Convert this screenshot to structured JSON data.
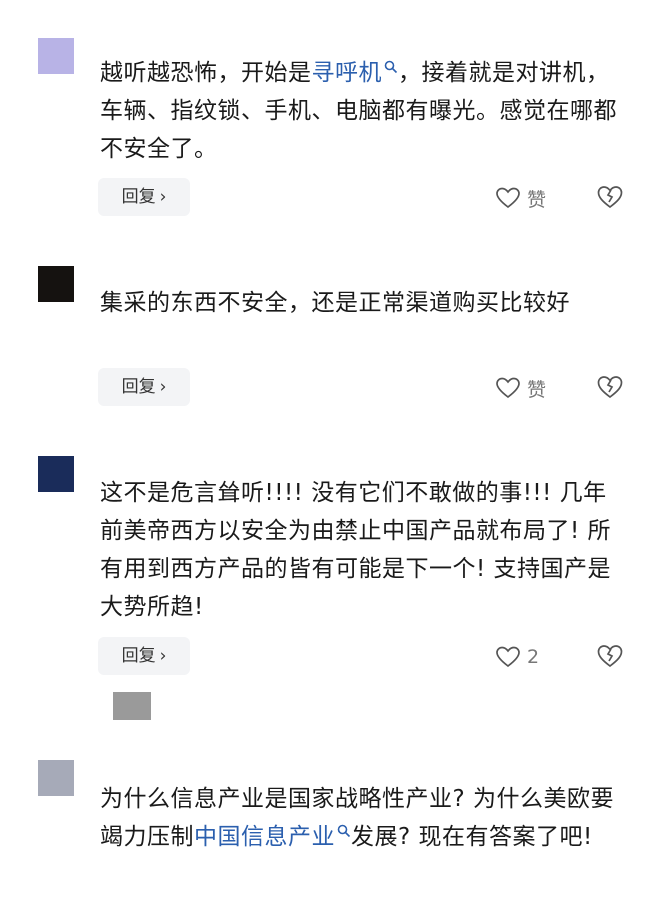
{
  "comments": [
    {
      "avatar_color": "#b8b3e6",
      "text_before": "越听越恐怖，开始是",
      "link": "寻呼机",
      "text_after": "，接着就是对讲机，车辆、指纹锁、手机、电脑都有曝光。感觉在哪都不安全了。",
      "reply_label": "回复",
      "like_label": "赞"
    },
    {
      "avatar_color": "#151210",
      "text": "集采的东西不安全，还是正常渠道购买比较好",
      "reply_label": "回复",
      "like_label": "赞"
    },
    {
      "avatar_color": "#1a2c5a",
      "text": "这不是危言耸听!!!! 没有它们不敢做的事!!! 几年前美帝西方以安全为由禁止中国产品就布局了! 所有用到西方产品的皆有可能是下一个! 支持国产是大势所趋!",
      "reply_label": "回复",
      "like_count": "2"
    },
    {
      "avatar_color": "#a6aab8",
      "text_before": "为什么信息产业是国家战略性产业? 为什么美欧要竭力压制",
      "link": "中国信息产业",
      "text_after": "发展? 现在有答案了吧!"
    }
  ],
  "icons": {
    "like": "heart-outline-icon",
    "dislike": "broken-heart-icon",
    "link_search": "search-icon",
    "reply_chevron": "chevron-right-icon"
  },
  "colors": {
    "link": "#2b5fae",
    "reply_bg": "#f3f4f6"
  }
}
